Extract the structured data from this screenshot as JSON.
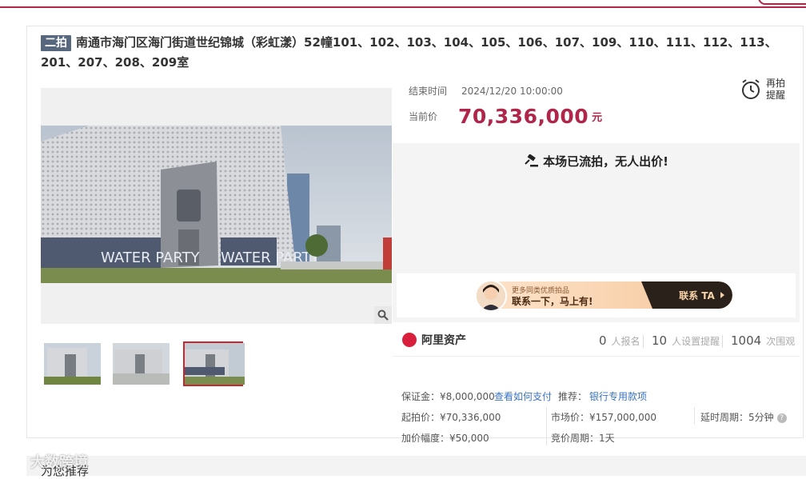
{
  "header": {
    "accent": "#b0254a"
  },
  "auction": {
    "badge": "二拍",
    "title": "南通市海门区海门街道世纪锦城（彩虹漾）52幢101、102、103、104、105、106、107、109、110、111、112、113、201、207、208、209室"
  },
  "gallery": {
    "main_photo_text_left": "WATER PARTY",
    "main_photo_text_right": "WATER PARTY",
    "zoom_icon": "search-icon",
    "thumbnails": [
      {
        "label": "thumb-1",
        "active": false
      },
      {
        "label": "thumb-2",
        "active": false
      },
      {
        "label": "thumb-3",
        "active": true
      }
    ]
  },
  "info": {
    "end_label": "结束时间",
    "end_time": "2024/12/20 10:00:00",
    "remind_line1": "再拍",
    "remind_line2": "提醒",
    "price_label": "当前价",
    "price_value": "70,336,000",
    "price_unit": "元",
    "status": "本场已流拍，无人出价!",
    "promo_sub": "更多同类优质拍品",
    "promo_main": "联系一下，马上有!",
    "promo_button": "联系 TA"
  },
  "stats": {
    "platform": "阿里资产",
    "signup_count": "0",
    "signup_label": "人报名",
    "remind_count": "10",
    "remind_label": "人设置提醒",
    "view_count": "1004",
    "view_label": "次围观"
  },
  "details": {
    "deposit": "保证金：¥8,000,000",
    "how_to_pay": "查看如何支付",
    "recommend_label": "推荐：",
    "recommend_link": "银行专用款项",
    "start_price": "起拍价：¥70,336,000",
    "market_price": "市场价：¥157,000,000",
    "delay_period": "延时周期：5分钟",
    "increment": "加价幅度：¥50,000",
    "bid_period": "竞价周期：1天"
  },
  "recommend": {
    "title": "为您推荐"
  },
  "watermark": {
    "text": "大数跨境"
  }
}
